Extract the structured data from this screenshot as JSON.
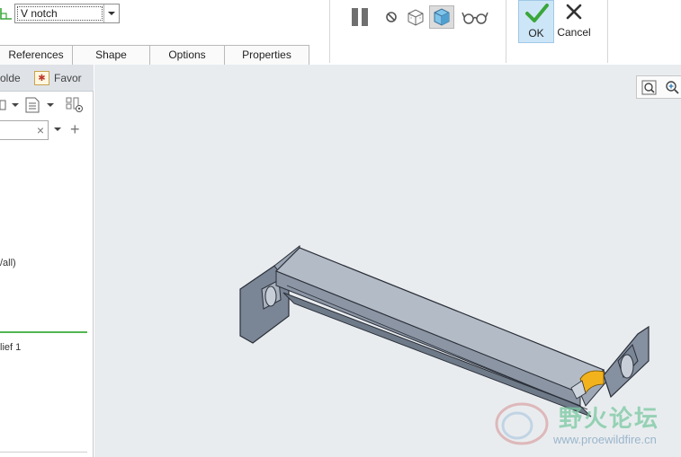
{
  "ribbon": {
    "shape_select": {
      "value": "V notch"
    },
    "tabs": [
      {
        "label": "References"
      },
      {
        "label": "Shape"
      },
      {
        "label": "Options"
      },
      {
        "label": "Properties"
      }
    ],
    "ok_label": "OK",
    "cancel_label": "Cancel"
  },
  "left_panel": {
    "folder_tab_label": "olde",
    "favorites_tab_label": "Favor",
    "tree_items": [
      {
        "label": "/all)"
      },
      {
        "label": "lief 1"
      }
    ]
  },
  "watermark": {
    "title": "野火论坛",
    "url": "www.proewildfire.cn"
  },
  "colors": {
    "accent_ok": "#cde6f7",
    "check_green": "#3aa63a",
    "graphics_bg": "#e9ecef",
    "model_gray": "#8a95a6",
    "highlight_yellow": "#f2b21c",
    "tree_marker_green": "#52b552"
  },
  "icons": {
    "shape": "sheetmetal-shape-icon",
    "pause": "pause-icon",
    "stop": "no-geometry-icon",
    "wireframe": "verify-mode-icon",
    "preview": "dynamic-preview-icon",
    "glasses": "glasses-preview-icon",
    "ok": "checkmark-icon",
    "cancel": "close-x-icon",
    "folder": "folder-browser-icon",
    "favorites": "favorites-star-icon",
    "zoom": "zoom-icon"
  }
}
